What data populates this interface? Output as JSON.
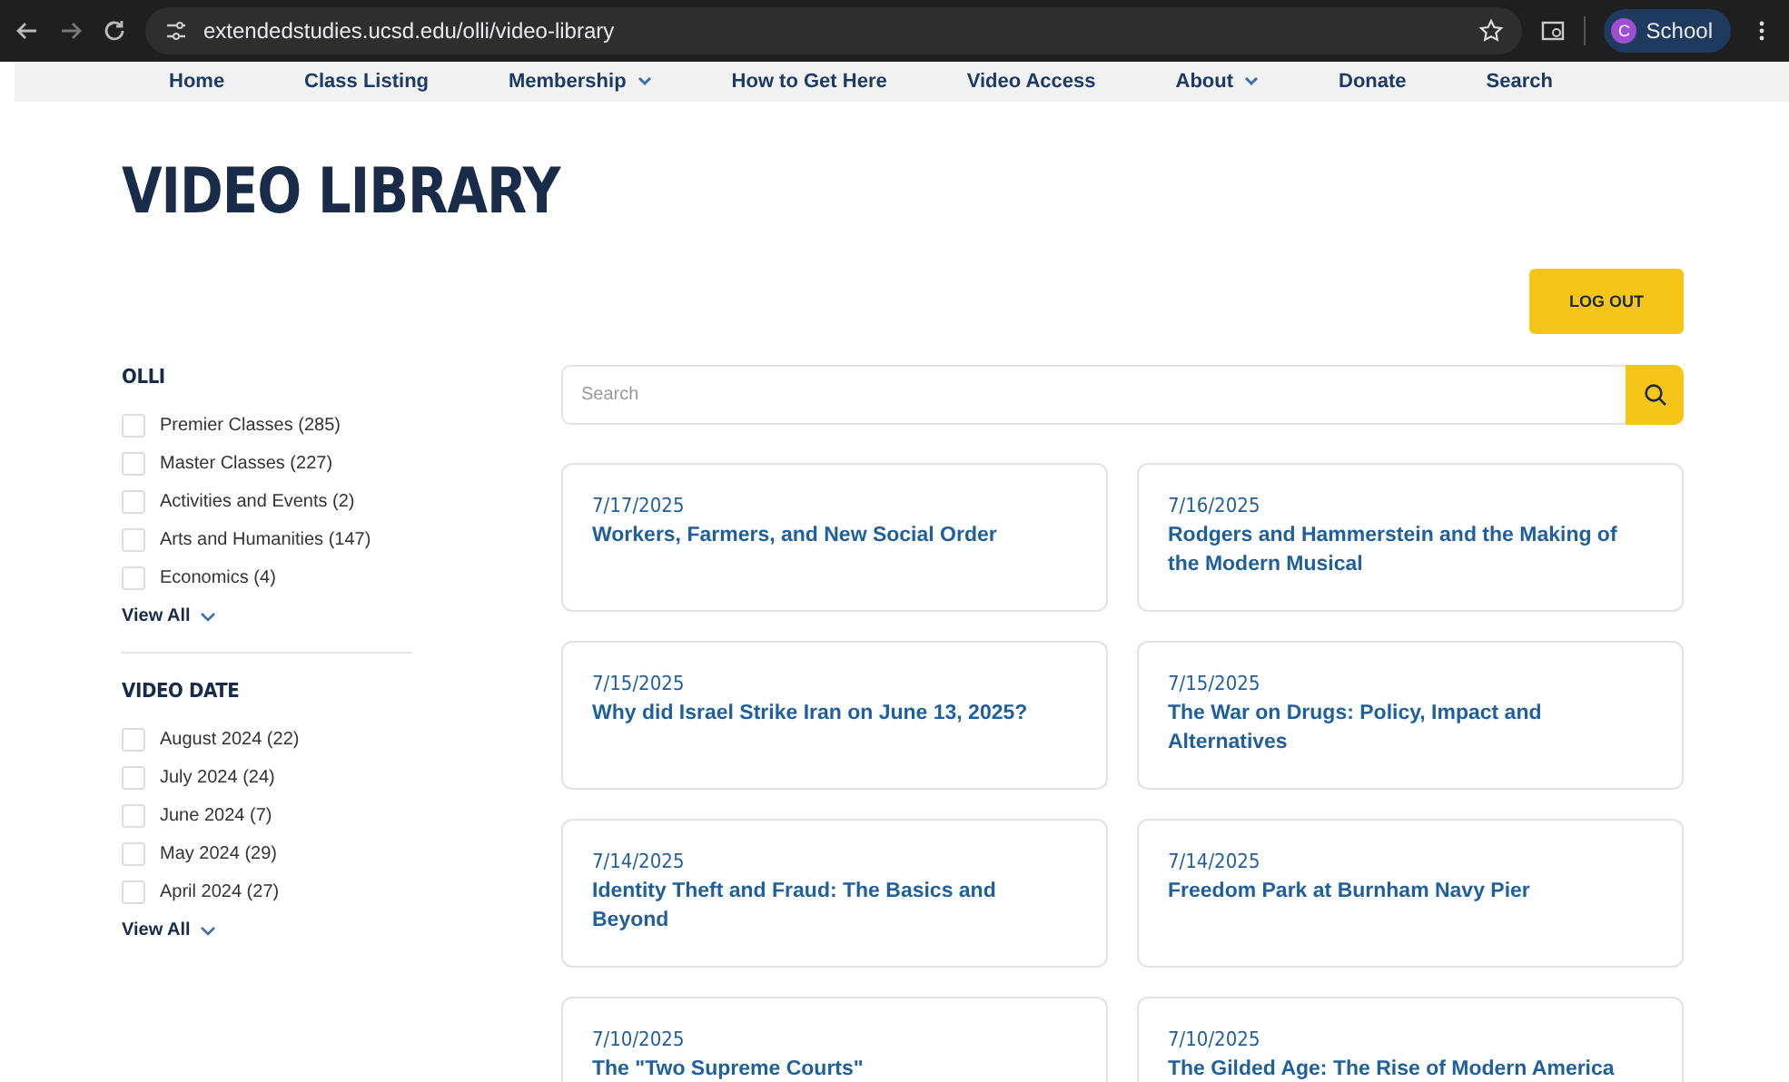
{
  "browser": {
    "url": "extendedstudies.ucsd.edu/olli/video-library",
    "profile_initial": "C",
    "profile_name": "School"
  },
  "nav": [
    {
      "label": "Home",
      "has_menu": false
    },
    {
      "label": "Class Listing",
      "has_menu": false
    },
    {
      "label": "Membership",
      "has_menu": true
    },
    {
      "label": "How to Get Here",
      "has_menu": false
    },
    {
      "label": "Video Access",
      "has_menu": false
    },
    {
      "label": "About",
      "has_menu": true
    },
    {
      "label": "Donate",
      "has_menu": false
    },
    {
      "label": "Search",
      "has_menu": false
    }
  ],
  "page_title": "VIDEO LIBRARY",
  "logout_button": "LOG OUT",
  "filters": [
    {
      "title": "OLLI",
      "view_all": "View All",
      "options": [
        {
          "label": "Premier Classes (285)",
          "checked": false
        },
        {
          "label": "Master Classes (227)",
          "checked": false
        },
        {
          "label": "Activities and Events (2)",
          "checked": false
        },
        {
          "label": "Arts and Humanities (147)",
          "checked": false
        },
        {
          "label": "Economics (4)",
          "checked": false
        }
      ]
    },
    {
      "title": "VIDEO DATE",
      "view_all": "View All",
      "options": [
        {
          "label": "August 2024 (22)",
          "checked": false
        },
        {
          "label": "July 2024 (24)",
          "checked": false
        },
        {
          "label": "June 2024 (7)",
          "checked": false
        },
        {
          "label": "May 2024 (29)",
          "checked": false
        },
        {
          "label": "April 2024 (27)",
          "checked": false
        }
      ]
    }
  ],
  "search": {
    "placeholder": "Search"
  },
  "videos": [
    {
      "date": "7/17/2025",
      "title": "Workers, Farmers, and New Social Order"
    },
    {
      "date": "7/16/2025",
      "title": "Rodgers and Hammerstein and the Making of the Modern Musical"
    },
    {
      "date": "7/15/2025",
      "title": "Why did Israel Strike Iran on June 13, 2025?"
    },
    {
      "date": "7/15/2025",
      "title": "The War on Drugs: Policy, Impact and Alternatives"
    },
    {
      "date": "7/14/2025",
      "title": "Identity Theft and Fraud: The Basics and Beyond"
    },
    {
      "date": "7/14/2025",
      "title": "Freedom Park at Burnham Navy Pier"
    },
    {
      "date": "7/10/2025",
      "title": "The \"Two Supreme Courts\""
    },
    {
      "date": "7/10/2025",
      "title": "The Gilded Age: The Rise of Modern America"
    }
  ]
}
